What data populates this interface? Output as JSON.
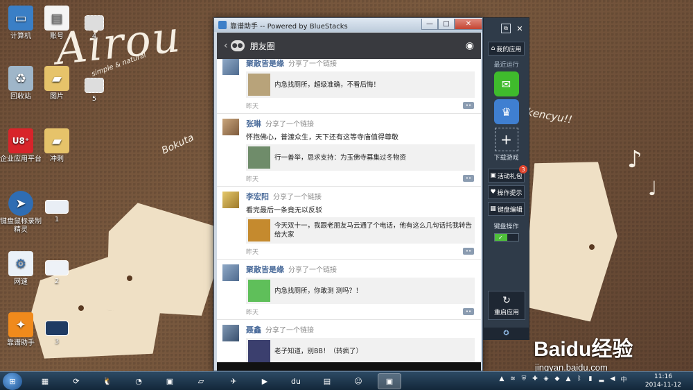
{
  "wallpaper": {
    "title": "Airou",
    "subtitle": "simple & natural",
    "text_left": "Bokuta",
    "text_right": "kencyu!!"
  },
  "desktop_icons": [
    {
      "label": "计算机",
      "icon": "computer-icon"
    },
    {
      "label": "账号",
      "icon": "document-icon"
    },
    {
      "label": "4",
      "icon": "image-file-icon"
    },
    {
      "label": "回收站",
      "icon": "recycle-bin-icon"
    },
    {
      "label": "图片",
      "icon": "folder-icon"
    },
    {
      "label": "5",
      "icon": "image-file-icon"
    },
    {
      "label": "企业应用平台",
      "icon": "u8-app-icon"
    },
    {
      "label": "冲刺",
      "icon": "folder-icon"
    },
    {
      "label": "键盘鼠标录制精灵",
      "icon": "recorder-icon"
    },
    {
      "label": "1",
      "icon": "image-file-icon"
    },
    {
      "label": "网速",
      "icon": "network-speed-icon"
    },
    {
      "label": "2",
      "icon": "image-file-icon"
    },
    {
      "label": "靠谱助手",
      "icon": "kaopu-icon"
    },
    {
      "label": "3",
      "icon": "image-file-icon"
    }
  ],
  "window": {
    "title": "靠谱助手  -- Powered by BlueStacks",
    "minimize": "—",
    "maximize": "□",
    "close": "✕"
  },
  "wechat": {
    "header_title": "朋友圈",
    "posts": [
      {
        "name": "聚散皆是缘",
        "action": "分享了一个链接",
        "text": "",
        "link": "内急找厕所，超级准确，不看后悔！",
        "time": "昨天",
        "thumb_color": "#b8a37a"
      },
      {
        "name": "张琳",
        "action": "分享了一个链接",
        "text": "怀抱佛心，普渡众生，天下还有这等寺庙值得尊敬",
        "link": "行一善举，恳求支持：为玉佛寺募集过冬物资",
        "time": "昨天",
        "thumb_color": "#6f8c6a"
      },
      {
        "name": "李宏阳",
        "action": "分享了一个链接",
        "text": "看完最后一条竟无以反驳",
        "link": "今天双十一，我跟老朋友马云通了个电话，他有这么几句话托我转告给大家",
        "time": "昨天",
        "thumb_color": "#c58a2e"
      },
      {
        "name": "聚散皆是缘",
        "action": "分享了一个链接",
        "text": "",
        "link": "内急找厕所，你敢测 测吗？！",
        "time": "昨天",
        "thumb_color": "#5fbf5a"
      },
      {
        "name": "聂鑫",
        "action": "分享了一个链接",
        "text": "",
        "link": "老子知道，别BB！（转疯了）",
        "time": "昨天",
        "thumb_color": "#3b3f6e"
      }
    ]
  },
  "sidebar": {
    "my_apps": "我的应用",
    "recent": "最近运行",
    "download_games": "下载游戏",
    "activity_gift": "活动礼包",
    "activity_badge": "3",
    "tips": "操作提示",
    "key_edit": "键盘编辑",
    "keyboard_op": "键盘操作",
    "restart": "重启应用"
  },
  "taskbar": {
    "time": "11:16",
    "date": "2014-11-12"
  },
  "watermark": {
    "main": "Baidu经验",
    "sub": "jingyan.baidu.com"
  }
}
